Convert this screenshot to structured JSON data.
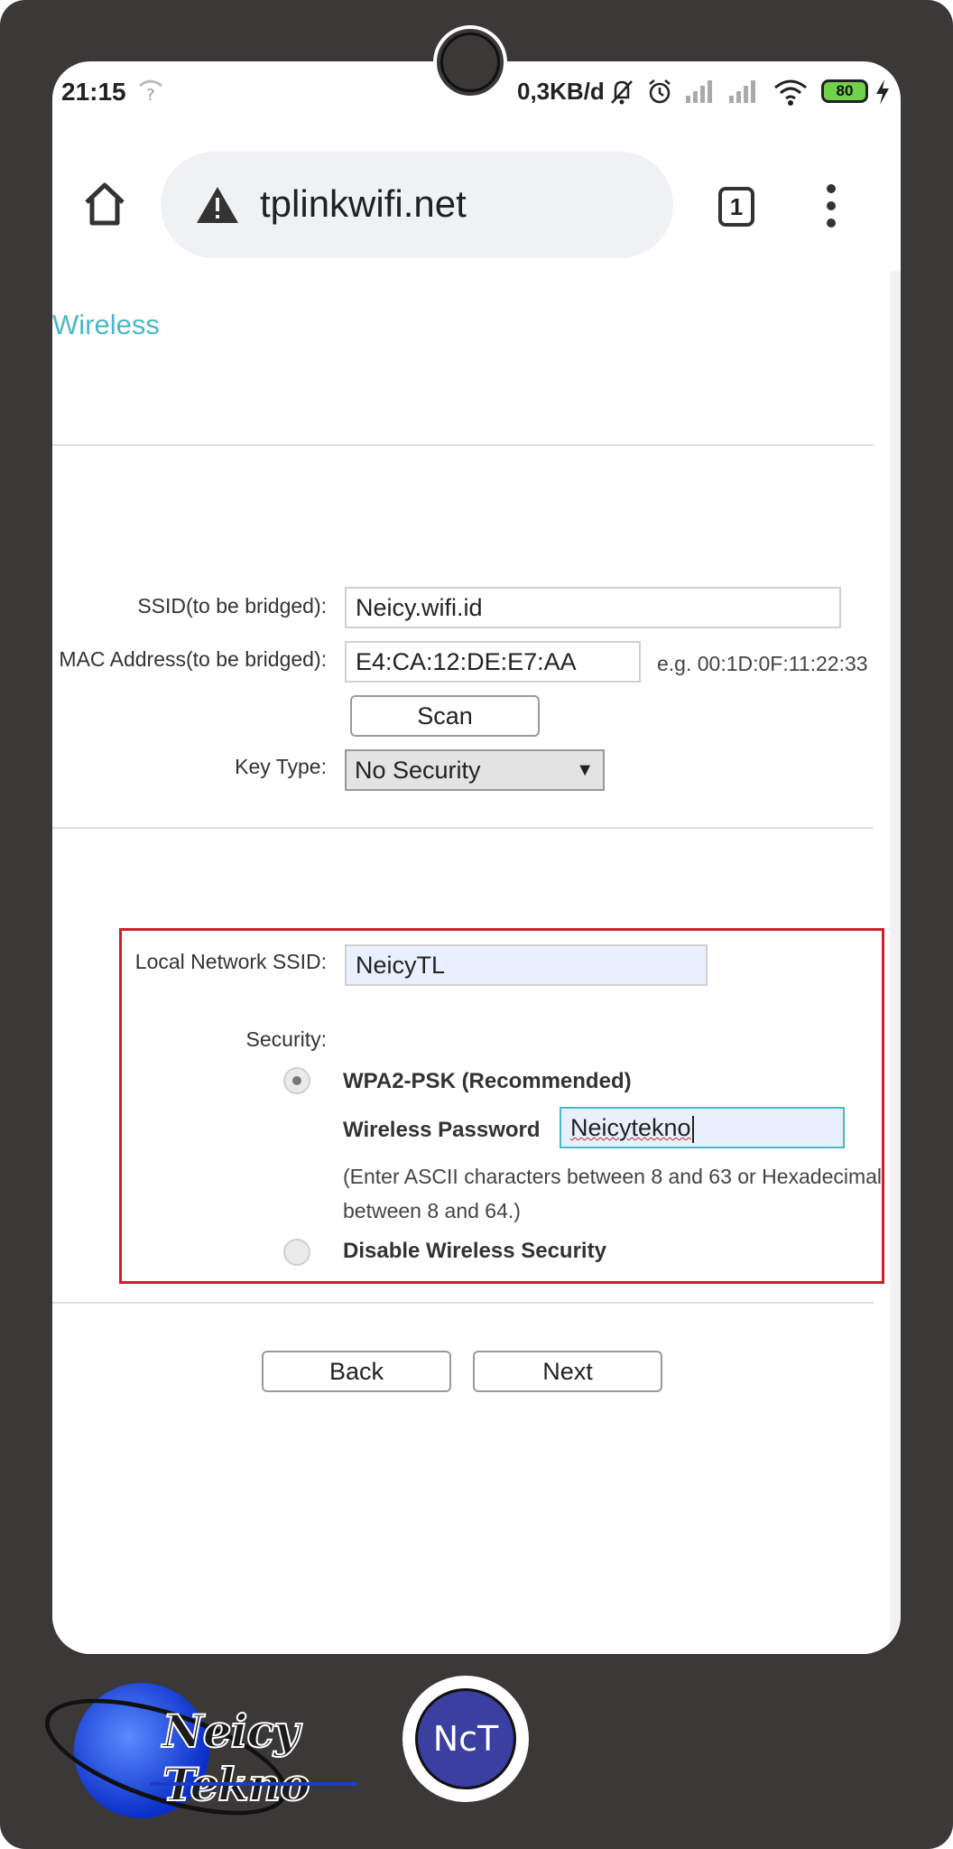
{
  "status_bar": {
    "time": "21:15",
    "net_speed": "0,3KB/d",
    "battery": "80"
  },
  "browser": {
    "url": "tplinkwifi.net",
    "tab_count": "1"
  },
  "page": {
    "section_title": "Wireless",
    "ssid_label": "SSID(to be bridged):",
    "ssid_value": "Neicy.wifi.id",
    "mac_label": "MAC Address(to be bridged):",
    "mac_value": "E4:CA:12:DE:E7:AA",
    "mac_hint": "e.g. 00:1D:0F:11:22:33",
    "scan_label": "Scan",
    "key_type_label": "Key Type:",
    "key_type_value": "No Security",
    "local_ssid_label": "Local Network SSID:",
    "local_ssid_value": "NeicyTL",
    "security_label": "Security:",
    "wpa2_label": "WPA2-PSK (Recommended)",
    "password_label": "Wireless Password",
    "password_value": "Neicytekno",
    "password_hint_line1": "(Enter ASCII characters between 8 and 63 or Hexadecimal",
    "password_hint_line2": "between 8 and 64.)",
    "disable_label": "Disable Wireless Security",
    "back_label": "Back",
    "next_label": "Next"
  },
  "branding": {
    "logo_text": "Neicy Tekno",
    "badge_text": "NcT"
  },
  "colors": {
    "accent": "#4bb8c9",
    "highlight_box": "#d21d2a",
    "frame": "#3b3838"
  }
}
